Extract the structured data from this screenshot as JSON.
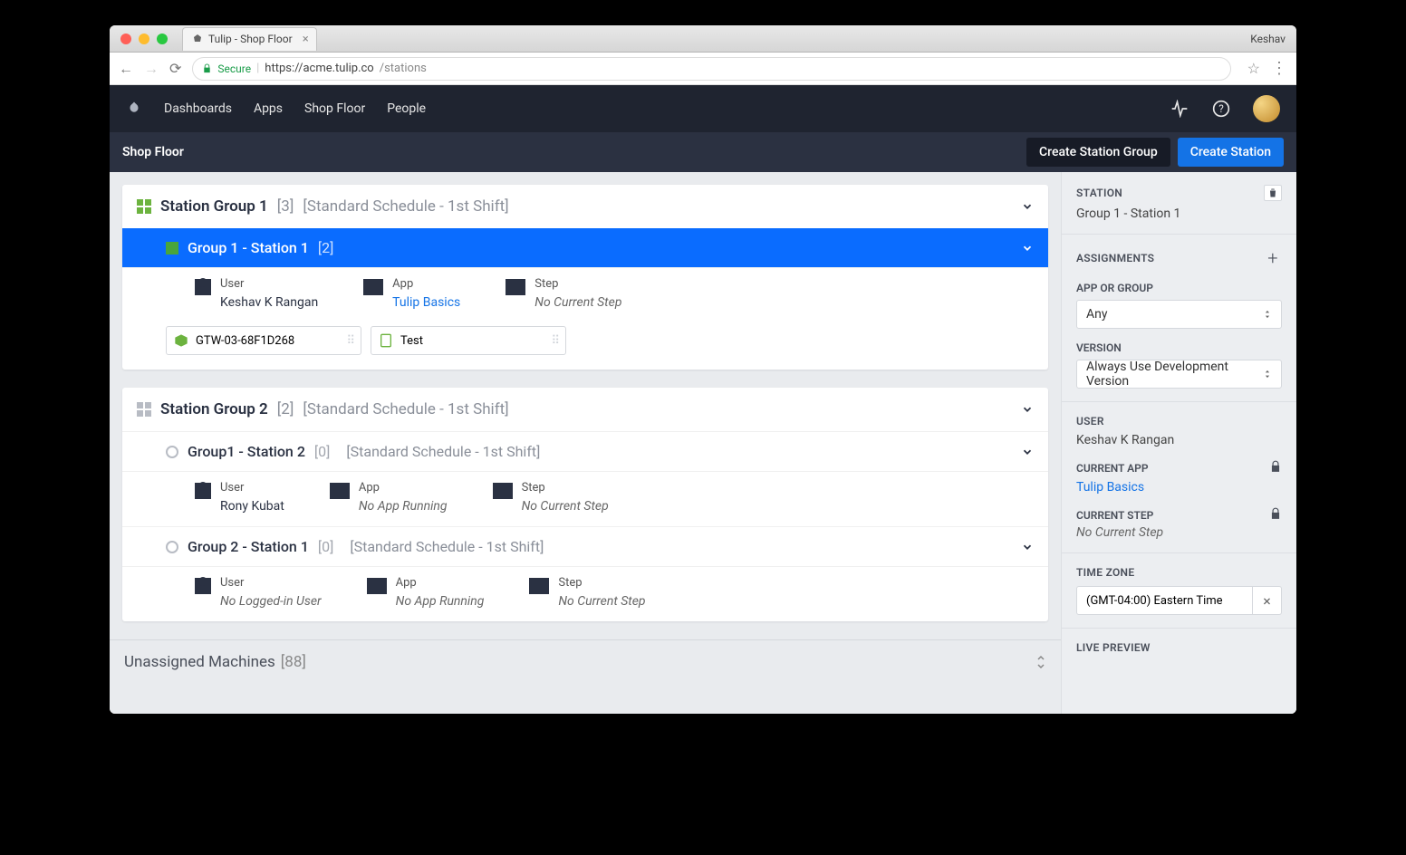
{
  "browser": {
    "tab_title": "Tulip - Shop Floor",
    "profile": "Keshav",
    "secure_label": "Secure",
    "url_prefix": "https://",
    "url_domain": "acme.tulip.co",
    "url_path": "/stations"
  },
  "nav": {
    "items": [
      "Dashboards",
      "Apps",
      "Shop Floor",
      "People"
    ]
  },
  "subbar": {
    "title": "Shop Floor",
    "btn_group": "Create Station Group",
    "btn_station": "Create Station"
  },
  "groups": [
    {
      "name": "Station Group 1",
      "count": "[3]",
      "schedule": "[Standard Schedule - 1st Shift]",
      "active_icon": true,
      "stations": [
        {
          "name": "Group 1 - Station 1",
          "count": "[2]",
          "selected": true,
          "schedule": "",
          "detail": {
            "user_label": "User",
            "user_val": "Keshav K Rangan",
            "app_label": "App",
            "app_val": "Tulip Basics",
            "app_link": true,
            "step_label": "Step",
            "step_val": "No Current Step",
            "step_italic": true
          },
          "chips": [
            {
              "icon_color": "#6cb33f",
              "label": "GTW-03-68F1D268",
              "shape": "hex"
            },
            {
              "icon_color": "#6cb33f",
              "label": "Test",
              "shape": "tablet"
            }
          ]
        }
      ]
    },
    {
      "name": "Station Group 2",
      "count": "[2]",
      "schedule": "[Standard Schedule - 1st Shift]",
      "active_icon": false,
      "stations": [
        {
          "name": "Group1 - Station 2",
          "count": "[0]",
          "selected": false,
          "schedule": "[Standard Schedule - 1st Shift]",
          "detail": {
            "user_label": "User",
            "user_val": "Rony Kubat",
            "app_label": "App",
            "app_val": "No App Running",
            "app_italic": true,
            "step_label": "Step",
            "step_val": "No Current Step",
            "step_italic": true
          }
        },
        {
          "name": "Group 2 - Station 1",
          "count": "[0]",
          "selected": false,
          "schedule": "[Standard Schedule - 1st Shift]",
          "detail": {
            "user_label": "User",
            "user_val": "No Logged-in User",
            "user_italic": true,
            "app_label": "App",
            "app_val": "No App Running",
            "app_italic": true,
            "step_label": "Step",
            "step_val": "No Current Step",
            "step_italic": true
          }
        }
      ]
    }
  ],
  "footer": {
    "title": "Unassigned Machines",
    "count": "[88]"
  },
  "panel": {
    "station_hdr": "STATION",
    "station_name": "Group 1 - Station 1",
    "assignments_hdr": "ASSIGNMENTS",
    "app_or_group_label": "APP OR GROUP",
    "app_or_group_val": "Any",
    "version_label": "VERSION",
    "version_val": "Always Use Development Version",
    "user_hdr": "USER",
    "user_val": "Keshav K Rangan",
    "current_app_hdr": "CURRENT APP",
    "current_app_val": "Tulip Basics",
    "current_step_hdr": "CURRENT STEP",
    "current_step_val": "No Current Step",
    "timezone_hdr": "TIME ZONE",
    "timezone_val": "(GMT-04:00) Eastern Time",
    "live_preview_hdr": "LIVE PREVIEW"
  }
}
